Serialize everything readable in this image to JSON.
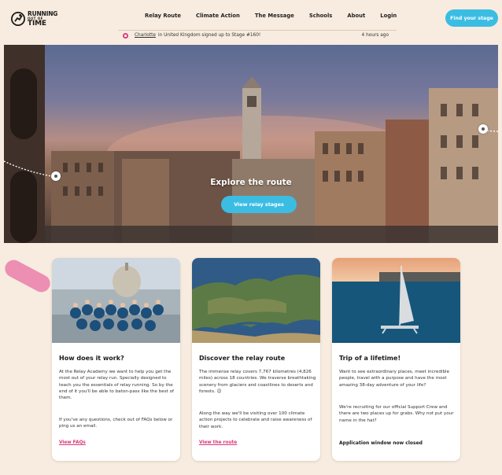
{
  "header": {
    "logo": {
      "line1": "RUNNING",
      "line2": "OUT OF",
      "line3": "TIME"
    },
    "nav": [
      "Relay Route",
      "Climate Action",
      "The Message",
      "Schools",
      "About",
      "Login"
    ],
    "cta_label": "Find your stage"
  },
  "ticker": {
    "name": "Charlotte",
    "message": "in United Kingdom signed up to Stage #160!",
    "time": "4 hours ago"
  },
  "hero": {
    "title": "Explore the route",
    "button_label": "View relay stages"
  },
  "cards": [
    {
      "title": "How does it work?",
      "p1": "At the Relay Academy we want to help you get the most out of your relay run. Specially designed to teach you the essentials of relay running. So by the end of it you'll be able to baton-pass like the best of them.",
      "p2": "If you've any questions, check out of FAQs below or ping us an email.",
      "link": "View FAQs"
    },
    {
      "title": "Discover the relay route",
      "p1": "The immense relay covers 7,767 kilometres (4,826 miles) across 18 countries. We traverse breathtaking scenery from glaciers and coastlines to deserts and forests. 😊",
      "p2": "Along the way we'll be visiting over 100 climate action projects to celebrate and raise awareness of their work.",
      "link": "View the route"
    },
    {
      "title": "Trip of a lifetime!",
      "p1": "Want to see extraordinary places, meet incredible people, travel with a purpose and have the most amazing 38-day adventure of your life?",
      "p2": "We're recruiting for our official Support Crew and there are two places up for grabs. Why not put your name in the hat?",
      "closed": "Application window now closed"
    }
  ],
  "colors": {
    "accent": "#3bbde3",
    "pink": "#d83a7b",
    "background": "#f7ecdf"
  }
}
